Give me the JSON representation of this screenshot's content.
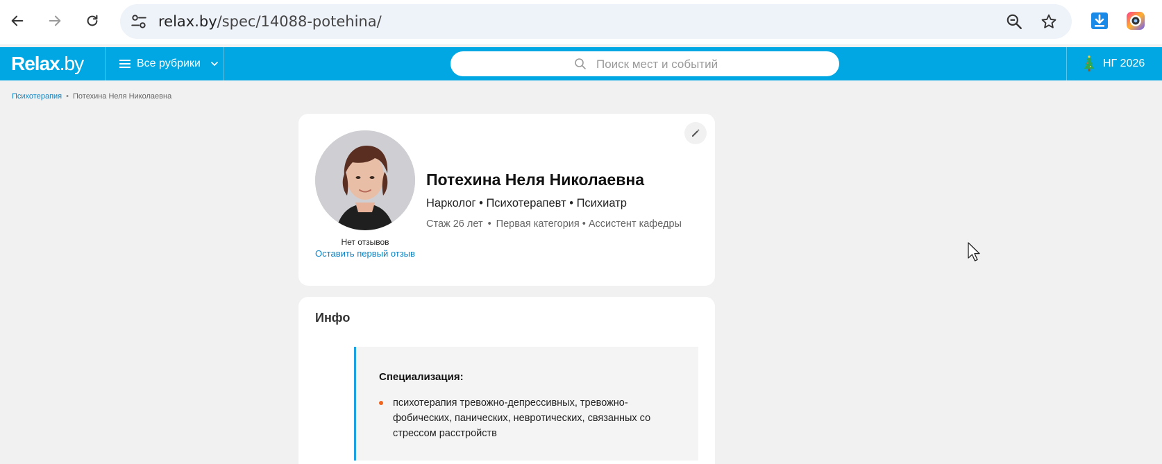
{
  "browser": {
    "url_host": "relax.by",
    "url_path": "/spec/14088-potehina/"
  },
  "site": {
    "logo_main": "Relax",
    "logo_suffix": ".by",
    "rubrics_label": "Все рубрики",
    "search_placeholder": "Поиск мест и событий",
    "ny_label": "НГ 2026",
    "brand_color": "#00a7e3",
    "accent_color": "#f0641e"
  },
  "breadcrumb": {
    "items": [
      "Психотерапия",
      "Потехина Неля Николаевна"
    ],
    "separator": "•"
  },
  "profile": {
    "name": "Потехина Неля Николаевна",
    "specialties": "Нарколог • Психотерапевт • Психиатр",
    "experience": "Стаж 26 лет",
    "meta_sep": "•",
    "category": "Первая категория • Ассистент кафедры",
    "reviews_status": "Нет отзывов",
    "first_review_link": "Оставить первый отзыв"
  },
  "info": {
    "title": "Инфо",
    "specialization_heading": "Специализация:",
    "specialization_items": [
      "психотерапия тревожно-депрессивных, тревожно-фобических, панических, невротических, связанных со стрессом расстройств"
    ]
  },
  "icons": {
    "back": "back-arrow-icon",
    "forward": "forward-arrow-icon",
    "reload": "reload-icon",
    "site_info": "tune-icon",
    "zoom": "zoom-out-icon",
    "bookmark": "star-icon",
    "extension_download": "download-icon",
    "extension_camera": "camera-extension-icon",
    "menu": "hamburger-icon",
    "search": "search-icon",
    "edit": "pencil-icon",
    "tree": "christmas-tree-icon"
  }
}
